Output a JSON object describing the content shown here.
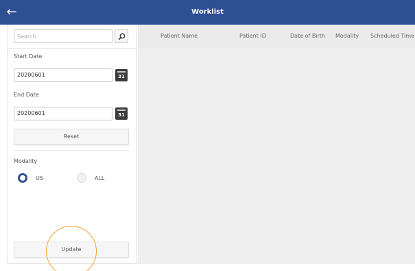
{
  "header": {
    "title": "Worklist",
    "back_icon": "arrow-left-icon"
  },
  "sidebar": {
    "search_placeholder": "Search",
    "search_icon": "search-icon",
    "start_date_label": "Start Date",
    "start_date_value": "20200601",
    "end_date_label": "End Date",
    "end_date_value": "20200601",
    "calendar_icon_text": "31",
    "reset_label": "Reset",
    "modality_label": "Modality",
    "modality_options": [
      {
        "label": "US",
        "selected": true
      },
      {
        "label": "ALL",
        "selected": false
      }
    ],
    "update_label": "Update"
  },
  "table": {
    "columns": [
      "Patient Name",
      "Patient ID",
      "Date of Birth",
      "Modality",
      "Scheduled Time"
    ]
  },
  "colors": {
    "titlebar": "#2f4f93",
    "accent_ring": "#f0a030",
    "content_bg": "#eeeeee"
  }
}
